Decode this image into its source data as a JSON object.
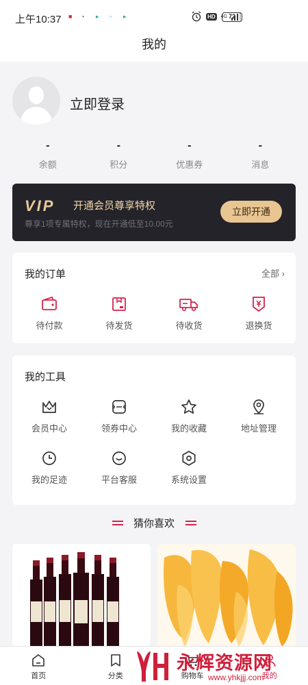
{
  "statusbar": {
    "time": "上午10:37",
    "hd": "HD",
    "network": "4G",
    "battery": "72"
  },
  "navbar": {
    "title": "我的"
  },
  "profile": {
    "login_label": "立即登录"
  },
  "stats": [
    {
      "value": "-",
      "label": "余额"
    },
    {
      "value": "-",
      "label": "积分"
    },
    {
      "value": "-",
      "label": "优惠券"
    },
    {
      "value": "-",
      "label": "消息"
    }
  ],
  "vip": {
    "logo": "VIP",
    "title": "开通会员尊享特权",
    "desc": "尊享1项专属特权，现在开通低至10.00元",
    "button": "立即开通"
  },
  "orders": {
    "title": "我的订单",
    "more": "全部 ›",
    "items": [
      {
        "label": "待付款",
        "icon": "wallet-icon"
      },
      {
        "label": "待发货",
        "icon": "package-icon"
      },
      {
        "label": "待收货",
        "icon": "truck-icon"
      },
      {
        "label": "退换货",
        "icon": "refund-icon"
      }
    ]
  },
  "tools": {
    "title": "我的工具",
    "items": [
      {
        "label": "会员中心",
        "icon": "crown-icon"
      },
      {
        "label": "领券中心",
        "icon": "coupon-icon"
      },
      {
        "label": "我的收藏",
        "icon": "star-icon"
      },
      {
        "label": "地址管理",
        "icon": "location-icon"
      },
      {
        "label": "我的足迹",
        "icon": "clock-icon"
      },
      {
        "label": "平台客服",
        "icon": "service-icon"
      },
      {
        "label": "系统设置",
        "icon": "settings-icon"
      }
    ]
  },
  "guess": {
    "title": "猜你喜欢"
  },
  "tabbar": {
    "items": [
      {
        "label": "首页",
        "icon": "home-icon"
      },
      {
        "label": "分类",
        "icon": "bookmark-icon"
      },
      {
        "label": "购物车",
        "icon": "cart-icon"
      },
      {
        "label": "我的",
        "icon": "user-icon"
      }
    ]
  },
  "watermark": {
    "text": "永辉资源网",
    "url": "www.yhkjjj.com"
  },
  "colors": {
    "accent": "#d6224a",
    "vip_gold": "#e8c591",
    "vip_bg": "#24232a"
  }
}
